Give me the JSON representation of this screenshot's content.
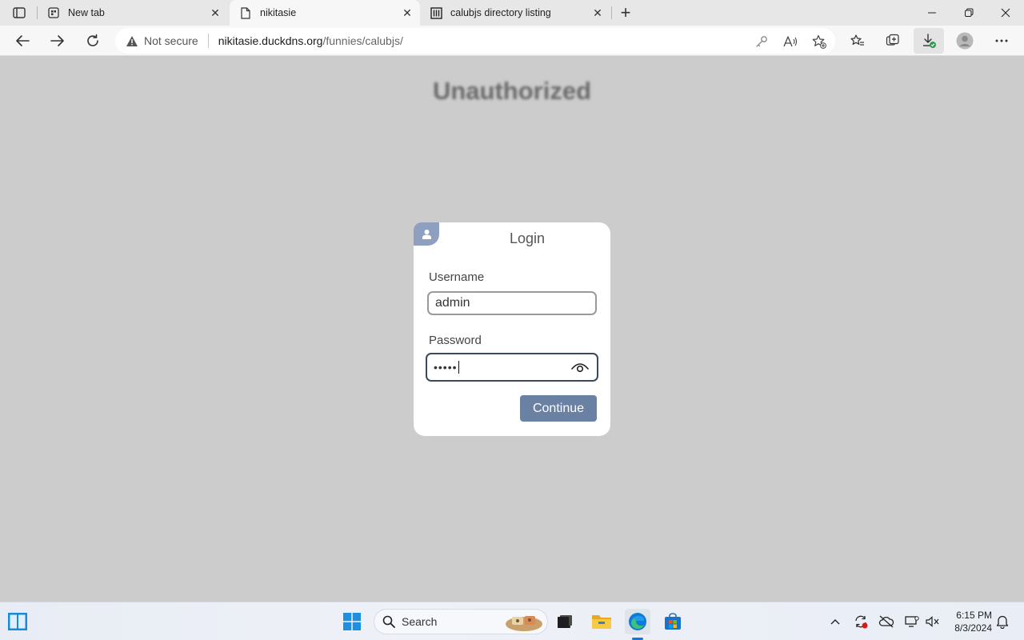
{
  "browser": {
    "tabs": [
      {
        "label": "New tab",
        "icon": "newtab-page-icon",
        "active": false
      },
      {
        "label": "nikitasie",
        "icon": "document-page-icon",
        "active": true
      },
      {
        "label": "calubjs directory listing",
        "icon": "directory-listing-icon",
        "active": false
      }
    ],
    "close_glyph": "✕",
    "new_tab_glyph": "+",
    "address": {
      "security_label": "Not secure",
      "host": "nikitasie.duckdns.org",
      "path": "/funnies/calubjs/"
    }
  },
  "page": {
    "title": "Unauthorized",
    "login": {
      "heading": "Login",
      "username_label": "Username",
      "username_value": "admin",
      "password_label": "Password",
      "password_masked": "•••••",
      "continue_label": "Continue"
    }
  },
  "taskbar": {
    "search_label": "Search",
    "time": "6:15 PM",
    "date": "8/3/2024"
  },
  "colors": {
    "page_background": "#cccccc",
    "button": "#6a81a4",
    "badge": "#8f9fc0",
    "edge_blue": "#0f7bd8"
  }
}
